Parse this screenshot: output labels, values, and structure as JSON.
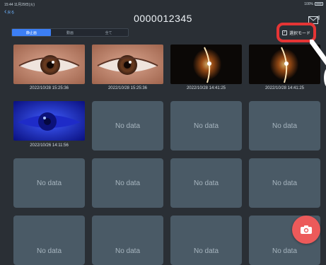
{
  "status_bar": {
    "time": "15:44 11月29日(火)",
    "battery": "100%"
  },
  "nav": {
    "back_label": "戻る",
    "title": "0000012345"
  },
  "tabs": [
    {
      "label": "静止画",
      "active": true
    },
    {
      "label": "動画",
      "active": false
    },
    {
      "label": "全て",
      "active": false
    }
  ],
  "select_mode": {
    "label": "選択モード"
  },
  "photos": [
    {
      "caption": "2022/10/28 15:25:36",
      "kind": "eye-brown"
    },
    {
      "caption": "2022/10/28 15:25:36",
      "kind": "eye-brown"
    },
    {
      "caption": "2022/10/28 14:41:25",
      "kind": "slit-lamp"
    },
    {
      "caption": "2022/10/28 14:41:25",
      "kind": "slit-lamp"
    },
    {
      "caption": "2022/10/26 14:11:56",
      "kind": "eye-blue"
    }
  ],
  "empty_label": "No data",
  "colors": {
    "accent": "#3c7ff5",
    "highlight": "#e53535",
    "fab": "#ec5a5a",
    "cell": "#4a5a66"
  },
  "icons": {
    "mail": "mail-icon",
    "camera": "camera-icon",
    "checkbox": "checkbox-icon"
  }
}
